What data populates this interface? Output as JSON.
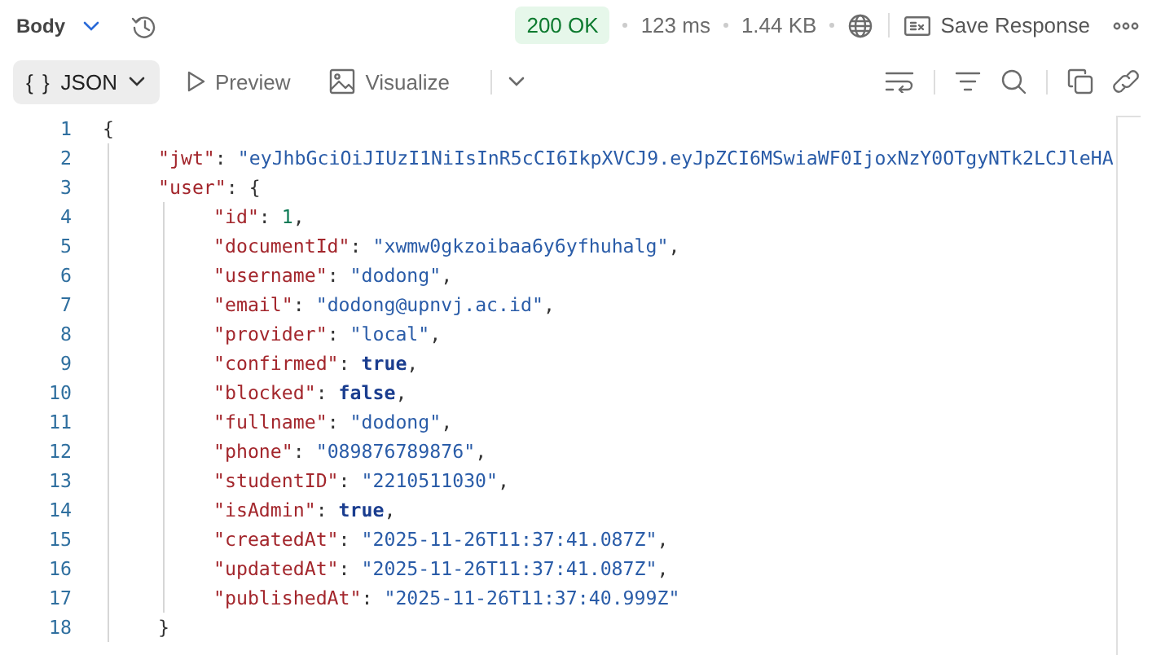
{
  "header": {
    "section": "Body",
    "status": "200 OK",
    "time": "123 ms",
    "size": "1.44 KB",
    "save": "Save Response"
  },
  "view_tabs": [
    {
      "label": "JSON",
      "icon": "{ }",
      "kind": "dropdown",
      "selected": true
    },
    {
      "label": "Preview",
      "kind": "play",
      "selected": false
    },
    {
      "label": "Visualize",
      "kind": "image",
      "selected": false
    }
  ],
  "code": [
    {
      "number": "1",
      "tokens": [
        {
          "kind": "punct",
          "text": "{"
        }
      ],
      "children": [
        {
          "number": "2",
          "tokens": [
            {
              "kind": "key",
              "text": "\"jwt\""
            },
            {
              "kind": "punct",
              "text": ": "
            },
            {
              "kind": "string",
              "text": "\"eyJhbGciOiJIUzI1NiIsInR5cCI6IkpXVCJ9.eyJpZCI6MSwiaWF0IjoxNzY0OTgyNTk2LCJleHA"
            }
          ]
        },
        {
          "number": "3",
          "tokens": [
            {
              "kind": "key",
              "text": "\"user\""
            },
            {
              "kind": "punct",
              "text": ": {"
            }
          ],
          "children": [
            {
              "number": "4",
              "tokens": [
                {
                  "kind": "key",
                  "text": "\"id\""
                },
                {
                  "kind": "punct",
                  "text": ": "
                },
                {
                  "kind": "number",
                  "text": "1"
                },
                {
                  "kind": "punct",
                  "text": ","
                }
              ]
            },
            {
              "number": "5",
              "tokens": [
                {
                  "kind": "key",
                  "text": "\"documentId\""
                },
                {
                  "kind": "punct",
                  "text": ": "
                },
                {
                  "kind": "string",
                  "text": "\"xwmw0gkzoibaa6y6yfhuhalg\""
                },
                {
                  "kind": "punct",
                  "text": ","
                }
              ]
            },
            {
              "number": "6",
              "tokens": [
                {
                  "kind": "key",
                  "text": "\"username\""
                },
                {
                  "kind": "punct",
                  "text": ": "
                },
                {
                  "kind": "string",
                  "text": "\"dodong\""
                },
                {
                  "kind": "punct",
                  "text": ","
                }
              ]
            },
            {
              "number": "7",
              "tokens": [
                {
                  "kind": "key",
                  "text": "\"email\""
                },
                {
                  "kind": "punct",
                  "text": ": "
                },
                {
                  "kind": "string",
                  "text": "\"dodong@upnvj.ac.id\""
                },
                {
                  "kind": "punct",
                  "text": ","
                }
              ]
            },
            {
              "number": "8",
              "tokens": [
                {
                  "kind": "key",
                  "text": "\"provider\""
                },
                {
                  "kind": "punct",
                  "text": ": "
                },
                {
                  "kind": "string",
                  "text": "\"local\""
                },
                {
                  "kind": "punct",
                  "text": ","
                }
              ]
            },
            {
              "number": "9",
              "tokens": [
                {
                  "kind": "key",
                  "text": "\"confirmed\""
                },
                {
                  "kind": "punct",
                  "text": ": "
                },
                {
                  "kind": "keyword",
                  "text": "true"
                },
                {
                  "kind": "punct",
                  "text": ","
                }
              ]
            },
            {
              "number": "10",
              "tokens": [
                {
                  "kind": "key",
                  "text": "\"blocked\""
                },
                {
                  "kind": "punct",
                  "text": ": "
                },
                {
                  "kind": "keyword",
                  "text": "false"
                },
                {
                  "kind": "punct",
                  "text": ","
                }
              ]
            },
            {
              "number": "11",
              "tokens": [
                {
                  "kind": "key",
                  "text": "\"fullname\""
                },
                {
                  "kind": "punct",
                  "text": ": "
                },
                {
                  "kind": "string",
                  "text": "\"dodong\""
                },
                {
                  "kind": "punct",
                  "text": ","
                }
              ]
            },
            {
              "number": "12",
              "tokens": [
                {
                  "kind": "key",
                  "text": "\"phone\""
                },
                {
                  "kind": "punct",
                  "text": ": "
                },
                {
                  "kind": "string",
                  "text": "\"089876789876\""
                },
                {
                  "kind": "punct",
                  "text": ","
                }
              ]
            },
            {
              "number": "13",
              "tokens": [
                {
                  "kind": "key",
                  "text": "\"studentID\""
                },
                {
                  "kind": "punct",
                  "text": ": "
                },
                {
                  "kind": "string",
                  "text": "\"2210511030\""
                },
                {
                  "kind": "punct",
                  "text": ","
                }
              ]
            },
            {
              "number": "14",
              "tokens": [
                {
                  "kind": "key",
                  "text": "\"isAdmin\""
                },
                {
                  "kind": "punct",
                  "text": ": "
                },
                {
                  "kind": "keyword",
                  "text": "true"
                },
                {
                  "kind": "punct",
                  "text": ","
                }
              ]
            },
            {
              "number": "15",
              "tokens": [
                {
                  "kind": "key",
                  "text": "\"createdAt\""
                },
                {
                  "kind": "punct",
                  "text": ": "
                },
                {
                  "kind": "string",
                  "text": "\"2025-11-26T11:37:41.087Z\""
                },
                {
                  "kind": "punct",
                  "text": ","
                }
              ]
            },
            {
              "number": "16",
              "tokens": [
                {
                  "kind": "key",
                  "text": "\"updatedAt\""
                },
                {
                  "kind": "punct",
                  "text": ": "
                },
                {
                  "kind": "string",
                  "text": "\"2025-11-26T11:37:41.087Z\""
                },
                {
                  "kind": "punct",
                  "text": ","
                }
              ]
            },
            {
              "number": "17",
              "tokens": [
                {
                  "kind": "key",
                  "text": "\"publishedAt\""
                },
                {
                  "kind": "punct",
                  "text": ": "
                },
                {
                  "kind": "string",
                  "text": "\"2025-11-26T11:37:40.999Z\""
                }
              ]
            }
          ]
        },
        {
          "number": "18",
          "tokens": [
            {
              "kind": "punct",
              "text": "}"
            }
          ]
        }
      ]
    }
  ]
}
